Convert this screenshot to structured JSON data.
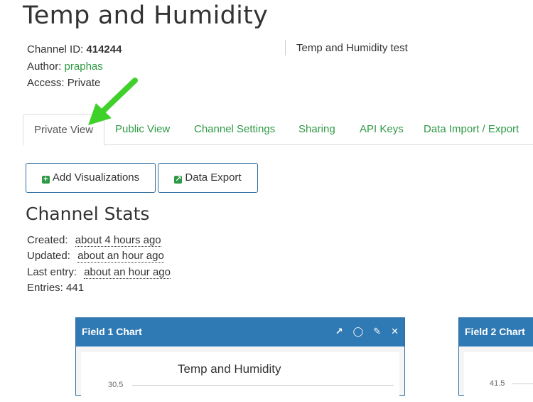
{
  "header": {
    "title": "Temp and Humidity"
  },
  "channel": {
    "id_label": "Channel ID:",
    "id_value": "414244",
    "author_label": "Author:",
    "author_value": "praphas",
    "access_label": "Access:",
    "access_value": "Private",
    "description": "Temp and Humidity test"
  },
  "tabs": [
    {
      "label": "Private View"
    },
    {
      "label": "Public View"
    },
    {
      "label": "Channel Settings"
    },
    {
      "label": "Sharing"
    },
    {
      "label": "API Keys"
    },
    {
      "label": "Data Import / Export"
    }
  ],
  "toolbar": {
    "add_visualizations_label": "Add Visualizations",
    "data_export_label": "Data Export"
  },
  "stats": {
    "title": "Channel Stats",
    "created_label": "Created:",
    "created_value": "about 4 hours ago",
    "updated_label": "Updated:",
    "updated_value": "about an hour ago",
    "last_entry_label": "Last entry:",
    "last_entry_value": "about an hour ago",
    "entries_text": "Entries: 441"
  },
  "panels": [
    {
      "title": "Field 1 Chart",
      "chart_title": "Temp and Humidity",
      "ytick": "30.5"
    },
    {
      "title": "Field 2 Chart",
      "ytick": "41.5"
    }
  ],
  "colors": {
    "brand_green": "#2f9a45",
    "panel_header_blue": "#2f79b4",
    "annotation_arrow": "#3fd12a"
  }
}
